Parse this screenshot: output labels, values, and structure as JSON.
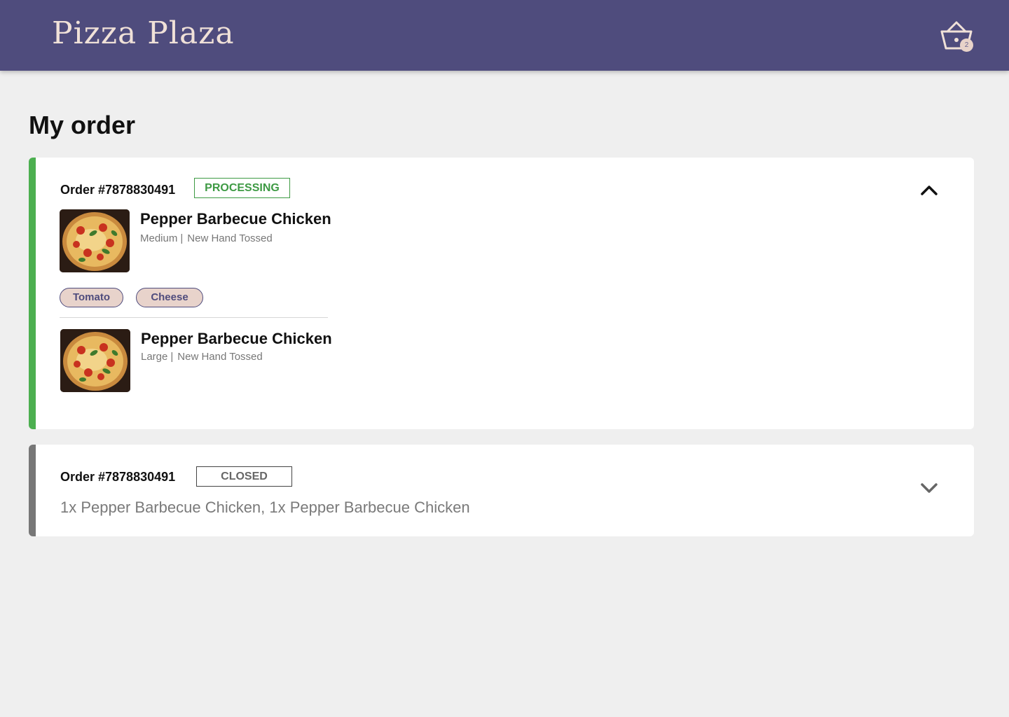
{
  "header": {
    "brand": "Pizza Plaza",
    "cart_count": "2",
    "bg_color": "#4f4c7d"
  },
  "page": {
    "title": "My order"
  },
  "orders": [
    {
      "number": "Order #7878830491",
      "status": "PROCESSING",
      "status_color": "#3e9a44",
      "expanded": true,
      "toggle_icon": "chevron-up-icon",
      "items": [
        {
          "name": "Pepper Barbecue Chicken",
          "size": "Medium",
          "crust": "New Hand Tossed",
          "toppings": [
            "Tomato",
            "Cheese"
          ]
        },
        {
          "name": "Pepper Barbecue Chicken",
          "size": "Large",
          "crust": "New Hand Tossed",
          "toppings": []
        }
      ]
    },
    {
      "number": "Order #7878830491",
      "status": "CLOSED",
      "status_color": "#666666",
      "expanded": false,
      "toggle_icon": "chevron-down-icon",
      "summary": "1x Pepper Barbecue Chicken, 1x Pepper Barbecue Chicken"
    }
  ]
}
